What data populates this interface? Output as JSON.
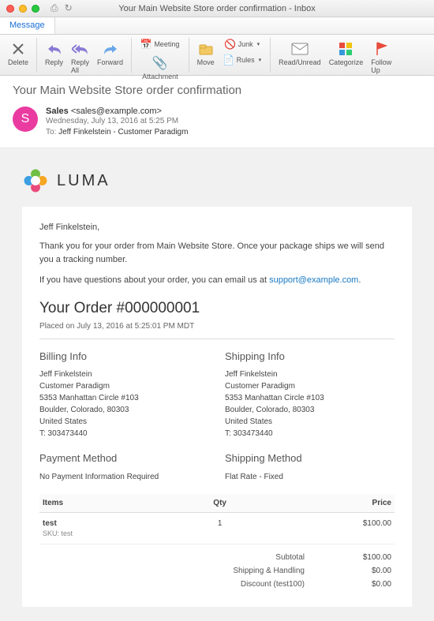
{
  "window": {
    "title": "Your Main Website Store order confirmation - Inbox"
  },
  "tabs": {
    "message": "Message"
  },
  "toolbar": {
    "delete": "Delete",
    "reply": "Reply",
    "reply_all": "Reply\nAll",
    "forward": "Forward",
    "meeting": "Meeting",
    "attachment": "Attachment",
    "move": "Move",
    "junk": "Junk",
    "rules": "Rules",
    "read_unread": "Read/Unread",
    "categorize": "Categorize",
    "follow_up": "Follow\nUp"
  },
  "subject": "Your Main Website Store order confirmation",
  "from": {
    "name": "Sales",
    "email": "<sales@example.com>",
    "initial": "S"
  },
  "date": "Wednesday, July 13, 2016 at 5:25 PM",
  "to_label": "To:",
  "to": "Jeff Finkelstein - Customer Paradigm",
  "brand": "LUMA",
  "email": {
    "greeting": "Jeff Finkelstein,",
    "p1": "Thank you for your order from Main Website Store. Once your package ships we will send you a tracking number.",
    "p2a": "If you have questions about your order, you can email us at ",
    "p2link": "support@example.com",
    "p2b": ".",
    "order_heading": "Your Order #000000001",
    "placed": "Placed on July 13, 2016 at 5:25:01 PM MDT",
    "billing_h": "Billing Info",
    "shipping_h": "Shipping Info",
    "addr": {
      "name": "Jeff Finkelstein",
      "company": "Customer Paradigm",
      "street": "5353 Manhattan Circle #103",
      "city": "Boulder, Colorado, 80303",
      "country": "United States",
      "phone": "T: 303473440"
    },
    "payment_h": "Payment Method",
    "payment_v": "No Payment Information Required",
    "shipmethod_h": "Shipping Method",
    "shipmethod_v": "Flat Rate - Fixed",
    "th_items": "Items",
    "th_qty": "Qty",
    "th_price": "Price",
    "item": {
      "name": "test",
      "sku_label": "SKU: test",
      "qty": "1",
      "price": "$100.00"
    },
    "totals": {
      "subtotal_l": "Subtotal",
      "subtotal_v": "$100.00",
      "shipping_l": "Shipping & Handling",
      "shipping_v": "$0.00",
      "discount_l": "Discount (test100)",
      "discount_v": "$0.00"
    }
  }
}
